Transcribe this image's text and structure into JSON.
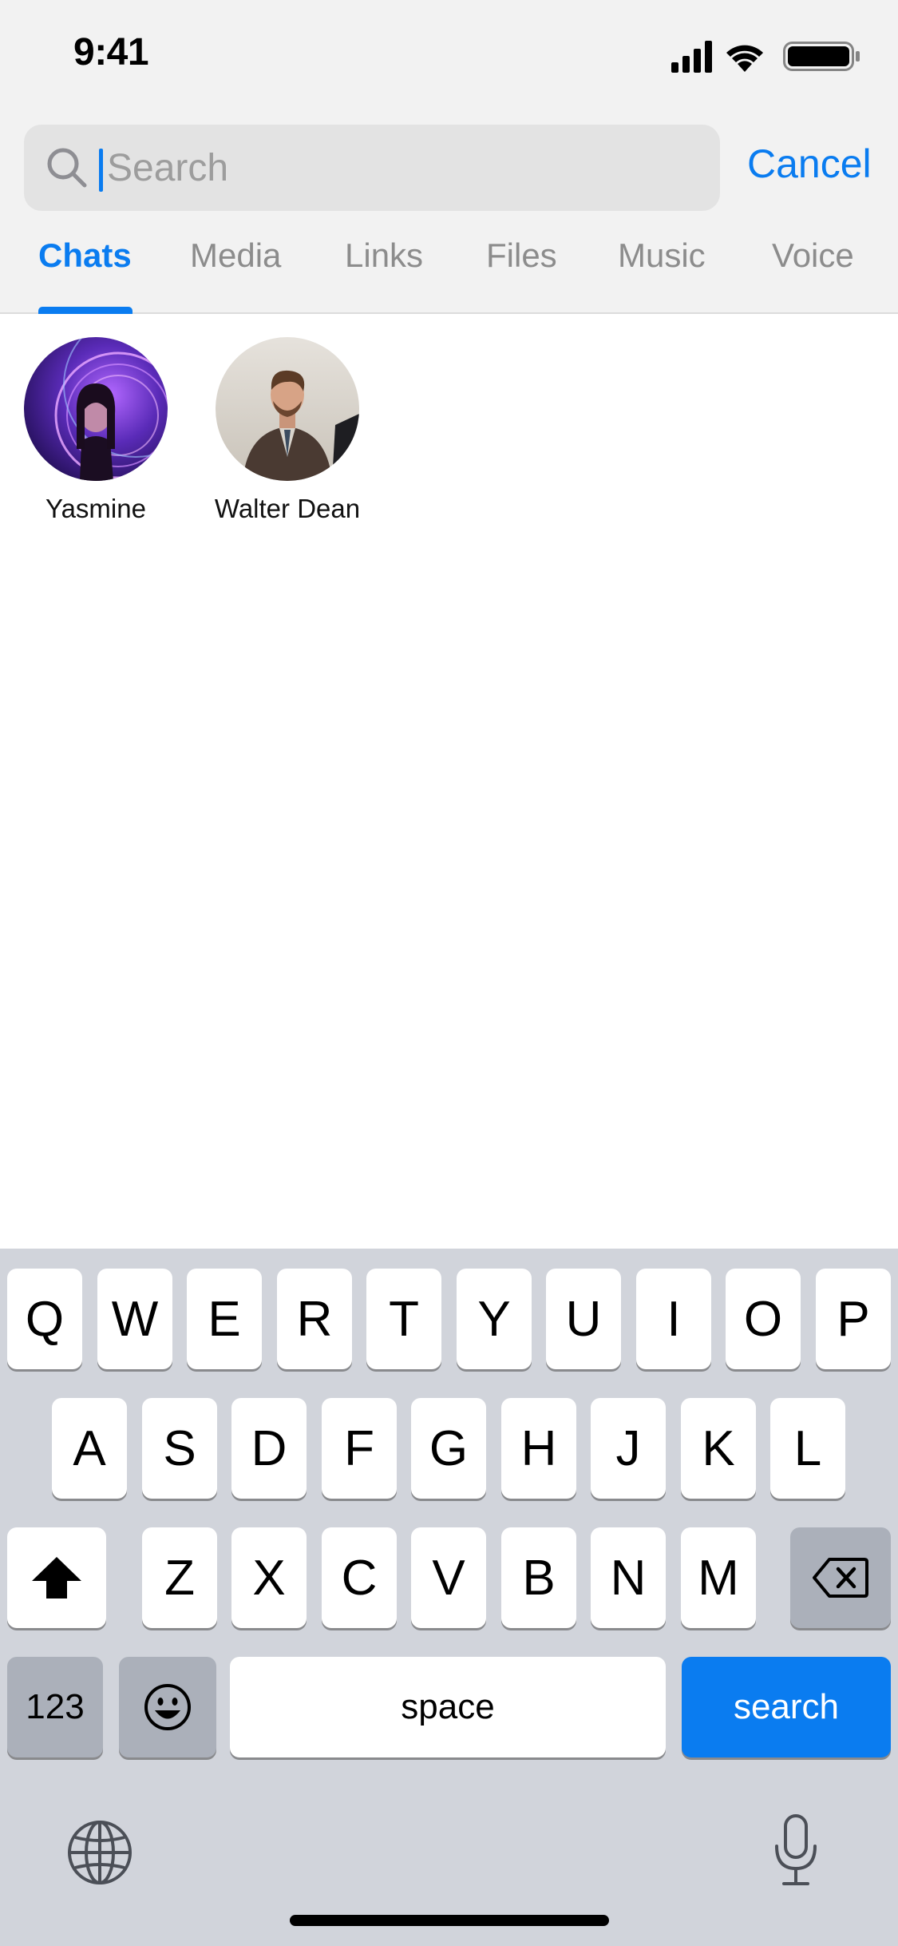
{
  "status_bar": {
    "time": "9:41",
    "icons": [
      "cellular-signal-icon",
      "wifi-icon",
      "battery-icon"
    ]
  },
  "search": {
    "placeholder": "Search",
    "value": "",
    "cancel_label": "Cancel"
  },
  "tabs": [
    {
      "label": "Chats",
      "active": true
    },
    {
      "label": "Media",
      "active": false
    },
    {
      "label": "Links",
      "active": false
    },
    {
      "label": "Files",
      "active": false
    },
    {
      "label": "Music",
      "active": false
    },
    {
      "label": "Voice",
      "active": false
    }
  ],
  "recent_chats": [
    {
      "name": "Yasmine"
    },
    {
      "name": "Walter Dean"
    }
  ],
  "keyboard": {
    "row1": [
      "Q",
      "W",
      "E",
      "R",
      "T",
      "Y",
      "U",
      "I",
      "O",
      "P"
    ],
    "row2": [
      "A",
      "S",
      "D",
      "F",
      "G",
      "H",
      "J",
      "K",
      "L"
    ],
    "row3": [
      "Z",
      "X",
      "C",
      "V",
      "B",
      "N",
      "M"
    ],
    "numbers_label": "123",
    "space_label": "space",
    "action_label": "search",
    "icons": [
      "shift-icon",
      "backspace-icon",
      "emoji-icon",
      "globe-icon",
      "microphone-icon"
    ]
  },
  "colors": {
    "accent": "#0a7cf0",
    "header_bg": "#f2f2f2",
    "keyboard_bg": "#d1d4db"
  }
}
